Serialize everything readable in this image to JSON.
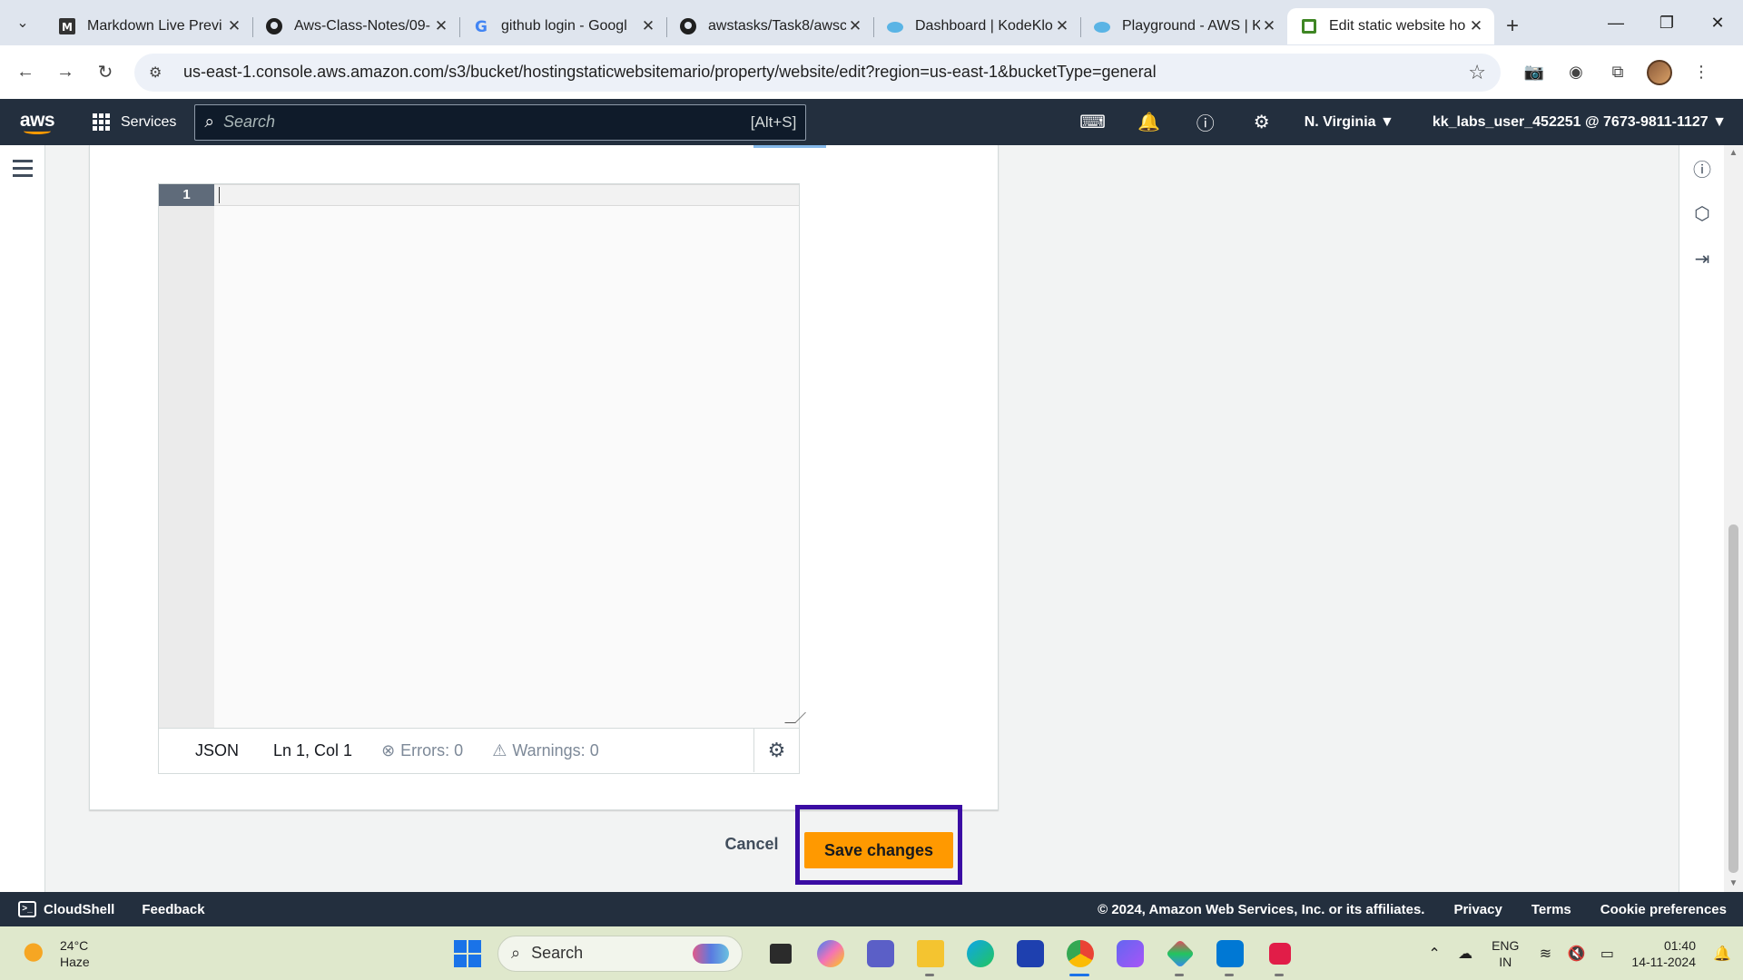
{
  "browser": {
    "tabs": [
      {
        "title": "Markdown Live Previ",
        "favicon": "markdown-icon"
      },
      {
        "title": "Aws-Class-Notes/09-",
        "favicon": "github-icon"
      },
      {
        "title": "github login - Googl",
        "favicon": "google-icon"
      },
      {
        "title": "awstasks/Task8/awsc",
        "favicon": "github-icon"
      },
      {
        "title": "Dashboard | KodeKlo",
        "favicon": "kodekloud-icon"
      },
      {
        "title": "Playground - AWS | K",
        "favicon": "kodekloud-icon"
      },
      {
        "title": "Edit static website ho",
        "favicon": "s3-icon",
        "active": true
      }
    ],
    "url": "us-east-1.console.aws.amazon.com/s3/bucket/hostingstaticwebsitemario/property/website/edit?region=us-east-1&bucketType=general"
  },
  "aws_nav": {
    "logo": "aws",
    "services_label": "Services",
    "search_placeholder": "Search",
    "search_shortcut": "[Alt+S]",
    "region": "N. Virginia",
    "account": "kk_labs_user_452251 @ 7673-9811-1127"
  },
  "editor": {
    "line_number": "1",
    "mode": "JSON",
    "position": "Ln 1, Col 1",
    "errors": "Errors: 0",
    "warnings": "Warnings: 0"
  },
  "actions": {
    "cancel_label": "Cancel",
    "save_label": "Save changes"
  },
  "footer": {
    "cloudshell": "CloudShell",
    "feedback": "Feedback",
    "copyright": "© 2024, Amazon Web Services, Inc. or its affiliates.",
    "privacy": "Privacy",
    "terms": "Terms",
    "cookies": "Cookie preferences"
  },
  "taskbar": {
    "temperature": "24°C",
    "weather": "Haze",
    "search_placeholder": "Search",
    "lang_top": "ENG",
    "lang_bottom": "IN",
    "time": "01:40",
    "date": "14-11-2024"
  },
  "colors": {
    "aws_nav": "#232f3e",
    "primary_button": "#ff9900",
    "highlight_box": "#3a0ca3"
  }
}
